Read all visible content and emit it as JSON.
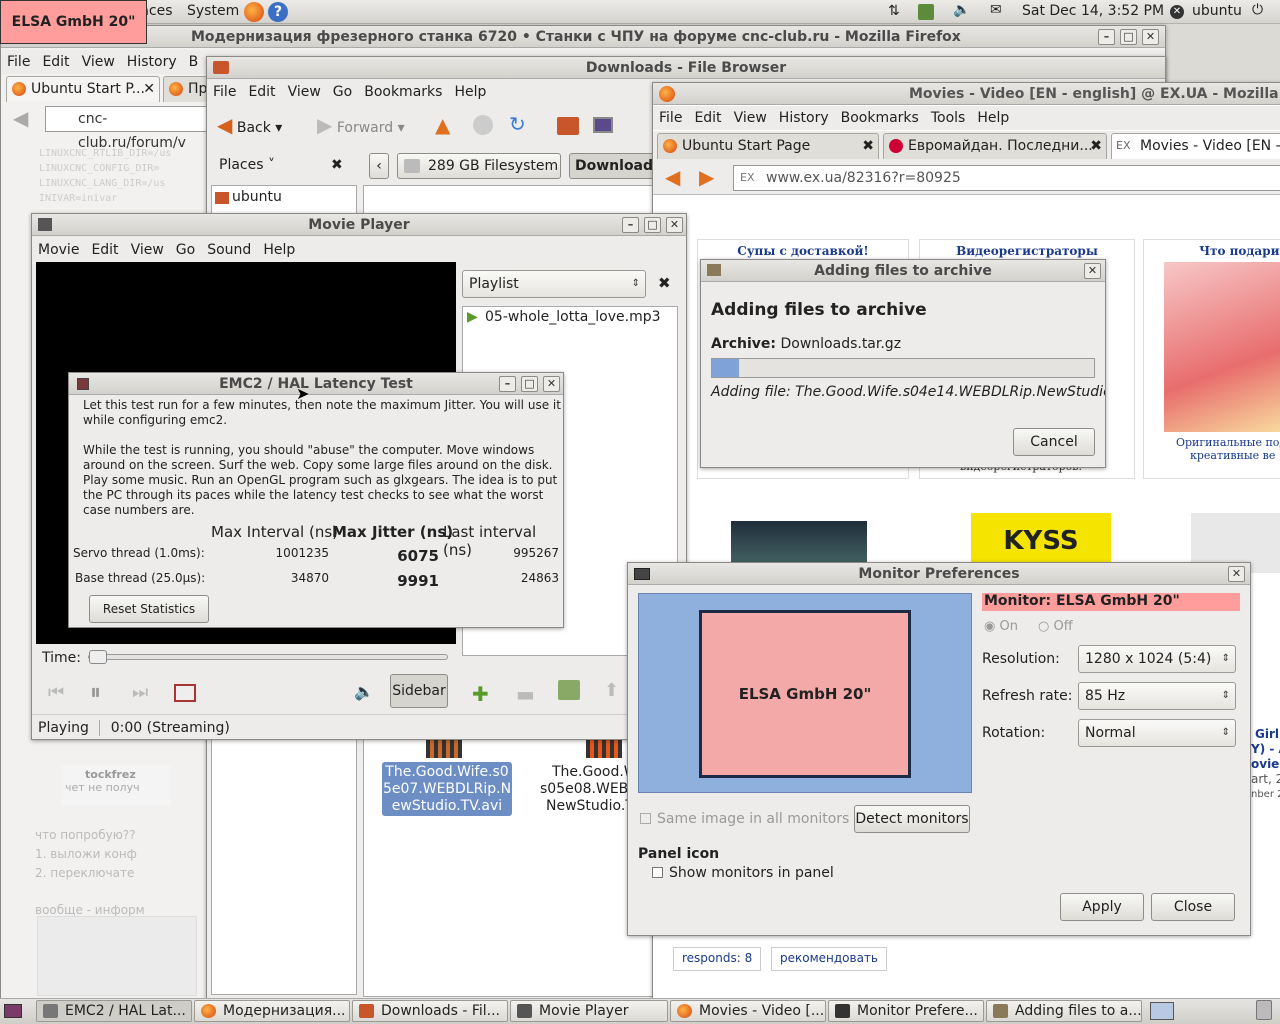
{
  "top_panel": {
    "menu_places": "Places",
    "menu_system": "System",
    "datetime": "Sat Dec 14,  3:52 PM",
    "user": "ubuntu"
  },
  "osd": {
    "label": "ELSA GmbH 20\""
  },
  "firefox_back": {
    "title": "Модернизация фрезерного станка 6720 • Станки с ЧПУ на форуме cnc-club.ru - Mozilla Firefox",
    "menu": [
      "File",
      "Edit",
      "View",
      "History",
      "B"
    ],
    "tabs": [
      "Ubuntu Start P...",
      "Пр"
    ],
    "url": "cnc-club.ru/forum/v",
    "page_lines": [
      "LINUXCNC_RTLIB_DIR=/us",
      "LINUXCNC_CONFIG_DIR=",
      "LINUXCNC_LANG_DIR=/us",
      "INIVAR=inivar"
    ],
    "quote_author": "tockfrez",
    "quote_text": "чет не получ",
    "para1": "что попробую??",
    "list1": "1. выложи конф",
    "list2": "2. переключате",
    "para2": "вообще - информ"
  },
  "file_browser": {
    "title": "Downloads - File Browser",
    "menu": [
      "File",
      "Edit",
      "View",
      "Go",
      "Bookmarks",
      "Help"
    ],
    "back": "Back",
    "forward": "Forward",
    "places": "Places",
    "place_ubuntu": "ubuntu",
    "location_fs": "289 GB Filesystem",
    "location_dl": "Downloads",
    "file1": "The.Good.Wife.s05e07.WEBDLRip.NewStudio.TV.avi",
    "file2a": "The.Good.W",
    "file2b": "s05e08.WEBD",
    "file2c": "NewStudio.T"
  },
  "firefox_front": {
    "title": "Movies - Video [EN - english] @ EX.UA - Mozilla F",
    "menu": [
      "File",
      "Edit",
      "View",
      "History",
      "Bookmarks",
      "Tools",
      "Help"
    ],
    "tabs": [
      "Ubuntu Start Page",
      "Евромайдан. Последни...",
      "Movies - Video [EN - e"
    ],
    "url": "www.ex.ua/82316?r=80925",
    "ad1": "Супы с доставкой!",
    "ad2": "Видеорегистраторы",
    "ad3": "Что подарит",
    "ad2_sub": "видеорегистраторов.",
    "ad3_sub1": "Оригинальные под",
    "ad3_sub2": "креативные ве",
    "responds": "responds: 8",
    "recommend": "рекомендовать",
    "side_lines": [
      "Girl",
      "Y) - A",
      "ovie",
      "art, 2",
      "nber 2"
    ]
  },
  "archive": {
    "title": "Adding files to archive",
    "heading": "Adding files to archive",
    "archive_label": "Archive:",
    "archive_value": "Downloads.tar.gz",
    "progress": 0.07,
    "adding": "Adding file: The.Good.Wife.s04e14.WEBDLRip.NewStudio...",
    "cancel": "Cancel"
  },
  "movie_player": {
    "title": "Movie Player",
    "menu": [
      "Movie",
      "Edit",
      "View",
      "Go",
      "Sound",
      "Help"
    ],
    "playlist_label": "Playlist",
    "playlist_item": "05-whole_lotta_love.mp3",
    "time_label": "Time:",
    "sidebar_btn": "Sidebar",
    "status": "Playing",
    "position": "0:00 (Streaming)"
  },
  "latency": {
    "title": "EMC2 / HAL Latency Test",
    "p1": "Let this test run for a few minutes, then note the maximum Jitter.  You will use it while configuring emc2.",
    "p2": "While the test is running, you should \"abuse\" the computer. Move windows around on the screen. Surf the web. Copy some large files around on the disk. Play some music. Run an OpenGL program such as glxgears. The idea is to put the PC through its paces while the latency test checks to see what the worst case numbers are.",
    "col_max": "Max Interval (ns)",
    "col_jitter": "Max Jitter (ns)",
    "col_last": "Last interval (ns)",
    "rows": [
      {
        "name": "Servo thread (1.0ms):",
        "max": "1001235",
        "jitter": "6075",
        "last": "995267"
      },
      {
        "name": "Base thread (25.0µs):",
        "max": "34870",
        "jitter": "9991",
        "last": "24863"
      }
    ],
    "reset": "Reset Statistics"
  },
  "monitor": {
    "title": "Monitor Preferences",
    "monitor_label": "Monitor: ELSA GmbH 20\"",
    "preview_label": "ELSA GmbH 20\"",
    "on": "On",
    "off": "Off",
    "resolution_label": "Resolution:",
    "resolution": "1280 x 1024 (5:4)",
    "refresh_label": "Refresh rate:",
    "refresh": "85 Hz",
    "rotation_label": "Rotation:",
    "rotation": "Normal",
    "same_image": "Same image in all monitors",
    "detect": "Detect monitors",
    "panel_icon": "Panel icon",
    "show_monitors": "Show monitors in panel",
    "apply": "Apply",
    "close": "Close"
  },
  "taskbar": [
    "EMC2 / HAL Lat...",
    "Модернизация...",
    "Downloads - Fil...",
    "Movie Player",
    "Movies - Video [...",
    "Monitor Prefere...",
    "Adding files to a..."
  ],
  "colors": {
    "accent_red": "#ff9d9d",
    "monitor_preview": "#f4a9a9",
    "monitor_bg": "#8fb0dc",
    "player_black": "#000000",
    "selection": "#6d8ec5"
  }
}
